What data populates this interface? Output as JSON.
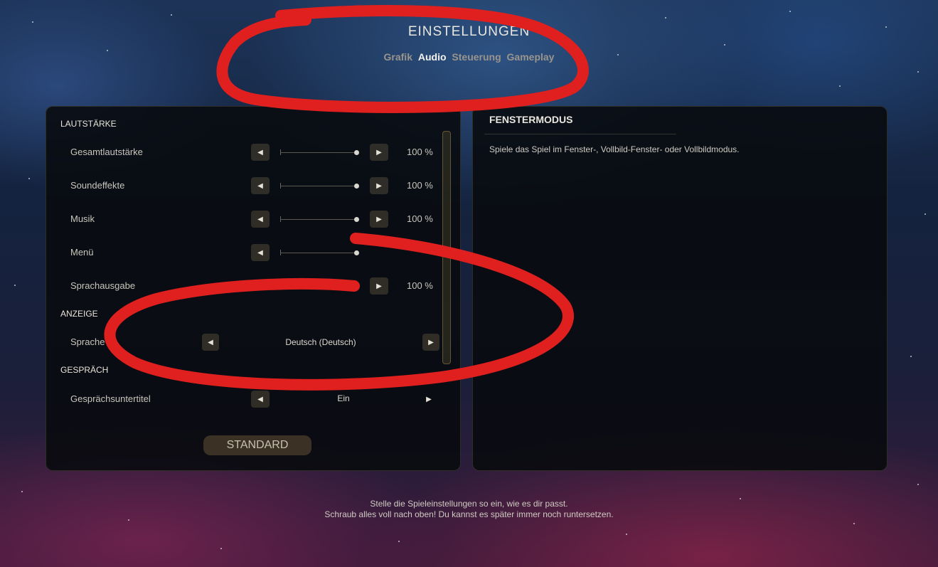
{
  "header": {
    "title": "EINSTELLUNGEN",
    "tabs": [
      {
        "label": "Grafik",
        "active": false
      },
      {
        "label": "Audio",
        "active": true
      },
      {
        "label": "Steuerung",
        "active": false
      },
      {
        "label": "Gameplay",
        "active": false
      }
    ]
  },
  "left_panel": {
    "sections": {
      "volume": "LAUTSTÄRKE",
      "display": "ANZEIGE",
      "dialogue": "GESPRÄCH"
    },
    "sliders": [
      {
        "label": "Gesamtlautstärke",
        "value": "100 %",
        "level": 1.0
      },
      {
        "label": "Soundeffekte",
        "value": "100 %",
        "level": 1.0
      },
      {
        "label": "Musik",
        "value": "100 %",
        "level": 1.0
      },
      {
        "label": "Menü",
        "value": "",
        "level": 1.0
      },
      {
        "label": "Sprachausgabe",
        "value": "100 %",
        "level": 1.0
      }
    ],
    "language": {
      "label": "Sprache",
      "value": "Deutsch (Deutsch)"
    },
    "subtitles": {
      "label": "Gesprächsuntertitel",
      "value": "Ein"
    },
    "standard_button": "STANDARD"
  },
  "right_panel": {
    "title": "FENSTERMODUS",
    "description": "Spiele das Spiel im Fenster-, Vollbild-Fenster- oder Vollbildmodus."
  },
  "footer": {
    "line1": "Stelle die Spieleinstellungen so ein, wie es dir passt.",
    "line2": "Schraub alles voll nach oben! Du kannst es später immer noch runtersetzen."
  },
  "icons": {
    "arrow_left": "◀",
    "arrow_right": "▶"
  },
  "colors": {
    "annotation_red": "#e0201e",
    "accent_gold": "#8a7a4a"
  }
}
